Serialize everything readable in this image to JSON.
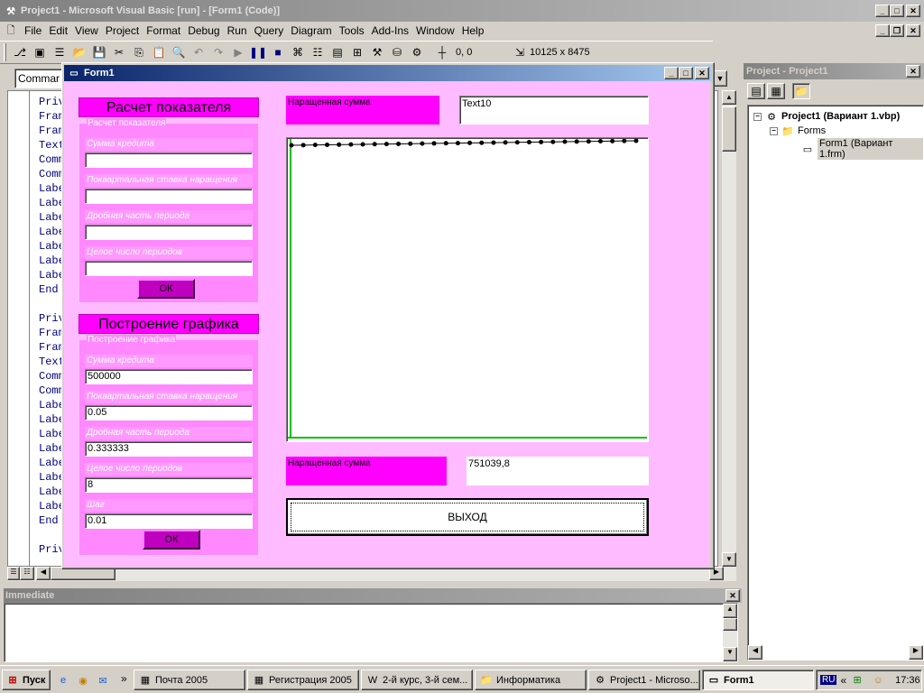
{
  "ide": {
    "title": "Project1 - Microsoft Visual Basic [run] - [Form1 (Code)]",
    "menu": [
      "File",
      "Edit",
      "View",
      "Project",
      "Format",
      "Debug",
      "Run",
      "Query",
      "Diagram",
      "Tools",
      "Add-Ins",
      "Window",
      "Help"
    ],
    "coords": "0, 0",
    "size": "10125 x 8475",
    "object_combo": "Commar"
  },
  "code_lines": [
    "Priv",
    "Fram",
    "Fram",
    "Text",
    "Comm",
    "Comm",
    "Labe",
    "Labe",
    "Labe",
    "Labe",
    "Labe",
    "Labe",
    "Labe",
    "End",
    "",
    "Priv",
    "Fram",
    "Fram",
    "Text",
    "Comm",
    "Comm",
    "Labe",
    "Labe",
    "Labe",
    "Labe",
    "Labe",
    "Labe",
    "Labe",
    "Labe",
    "End",
    "",
    "Priv"
  ],
  "project": {
    "title": "Project - Project1",
    "root": "Project1 (Вариант 1.vbp)",
    "folder": "Forms",
    "form": "Form1 (Вариант 1.frm)"
  },
  "immediate": {
    "title": "Immediate"
  },
  "form1": {
    "title": "Form1",
    "section1": {
      "header": "Расчет показателя",
      "frame_caption": "Расчет показателя",
      "fields": [
        {
          "label": "Сумма кредита",
          "value": ""
        },
        {
          "label": "Поквартальная ставка наращения",
          "value": ""
        },
        {
          "label": "Дробная часть периода",
          "value": ""
        },
        {
          "label": "Целое число периодов",
          "value": ""
        }
      ],
      "ok": "ОК"
    },
    "section2": {
      "header": "Построение графика",
      "frame_caption": "Построение графика",
      "fields": [
        {
          "label": "Сумма кредита",
          "value": "500000"
        },
        {
          "label": "Поквартальная ставка наращения",
          "value": "0.05"
        },
        {
          "label": "Дробная часть периода",
          "value": "0.333333"
        },
        {
          "label": "Целое число периодов",
          "value": "8"
        },
        {
          "label": "Шаг",
          "value": "0.01"
        }
      ],
      "ok": "ОК"
    },
    "top_label": "Наращенная сумма",
    "top_value": "Text10",
    "bottom_label": "Наращенная сумма",
    "bottom_value": "751039,8",
    "exit": "ВЫХОД"
  },
  "taskbar": {
    "start": "Пуск",
    "items": [
      "Почта 2005",
      "Регистрация 2005",
      "2-й курс, 3-й сем...",
      "Информатика",
      "Project1 - Microso...",
      "Form1"
    ],
    "lang": "RU",
    "time": "17:36"
  },
  "colors": {
    "form_bg": "#ffbbff",
    "accent": "#ff00ff",
    "button": "#c000c0",
    "axis": "#00c000"
  }
}
